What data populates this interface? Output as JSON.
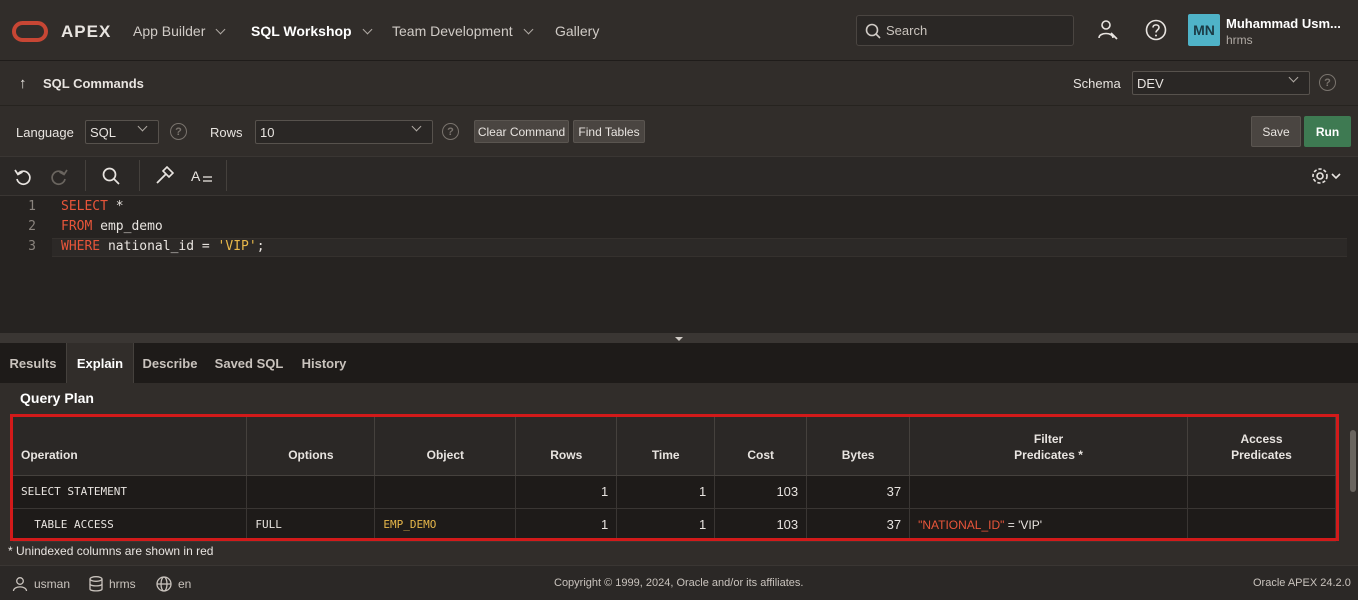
{
  "header": {
    "brand": "APEX",
    "nav": [
      {
        "label": "App Builder"
      },
      {
        "label": "SQL Workshop"
      },
      {
        "label": "Team Development"
      },
      {
        "label": "Gallery"
      }
    ],
    "search_placeholder": "Search",
    "user": {
      "initials": "MN",
      "name": "Muhammad Usm...",
      "workspace": "hrms"
    }
  },
  "subheader": {
    "title": "SQL Commands",
    "schema_label": "Schema",
    "schema_value": "DEV"
  },
  "toolbar": {
    "language_label": "Language",
    "language_value": "SQL",
    "rows_label": "Rows",
    "rows_value": "10",
    "clear_command": "Clear Command",
    "find_tables": "Find Tables",
    "save": "Save",
    "run": "Run"
  },
  "editor": {
    "line_numbers": [
      "1",
      "2",
      "3"
    ],
    "line1": {
      "kw": "SELECT",
      "rest": " *"
    },
    "line2": {
      "kw": "FROM",
      "rest": " emp_demo"
    },
    "line3": {
      "kw": "WHERE",
      "mid": " national_id = ",
      "str": "'VIP'",
      "end": ";"
    }
  },
  "tabs": [
    "Results",
    "Explain",
    "Describe",
    "Saved SQL",
    "History"
  ],
  "active_tab": "Explain",
  "plan": {
    "title": "Query Plan",
    "headers": {
      "operation": "Operation",
      "options": "Options",
      "object": "Object",
      "rows": "Rows",
      "time": "Time",
      "cost": "Cost",
      "bytes": "Bytes",
      "filter_1": "Filter",
      "filter_2": "Predicates *",
      "access_1": "Access",
      "access_2": "Predicates"
    },
    "rows": [
      {
        "operation": "SELECT STATEMENT",
        "options": "",
        "object": "",
        "rows": "1",
        "time": "1",
        "cost": "103",
        "bytes": "37",
        "filter_key": "",
        "filter_rest": "",
        "access": ""
      },
      {
        "operation": "  TABLE ACCESS",
        "options": "FULL",
        "object": "EMP_DEMO",
        "rows": "1",
        "time": "1",
        "cost": "103",
        "bytes": "37",
        "filter_key": "\"NATIONAL_ID\"",
        "filter_rest": " = 'VIP'",
        "access": ""
      }
    ],
    "note": "* Unindexed columns are shown in red"
  },
  "footer": {
    "user": "usman",
    "workspace": "hrms",
    "language": "en",
    "copyright": "Copyright © 1999, 2024, Oracle and/or its affiliates.",
    "version": "Oracle APEX 24.2.0"
  },
  "colors": {
    "run_button": "#3e7a52",
    "keyword": "#e8553a",
    "string": "#e8b84a",
    "highlight_border": "#d21a1a",
    "avatar_bg": "#4fb3c8"
  }
}
